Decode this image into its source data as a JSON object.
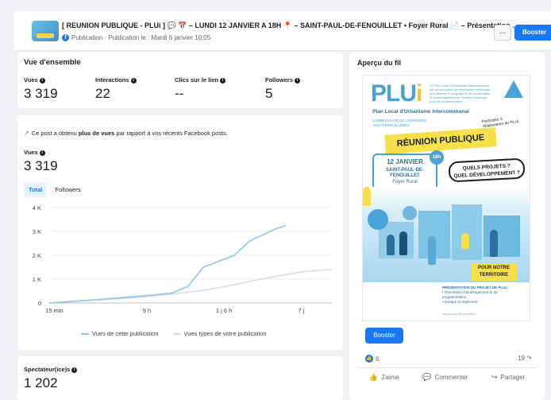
{
  "header": {
    "title": "[ REUNION PUBLIQUE - PLUi ] 💬 📅 – LUNDI 12 JANVIER A 18H 📍 – SAINT-PAUL-DE-FENOUILLET • Foyer Rural 📄 – Présentation ...",
    "subtitle": "Publication · Publication le : Mardi 6 janvier 10:05",
    "more_label": "...",
    "boost_label": "Booster"
  },
  "overview": {
    "title": "Vue d'ensemble",
    "metrics": [
      {
        "label": "Vues",
        "value": "3 319"
      },
      {
        "label": "Interactions",
        "value": "22"
      },
      {
        "label": "Clics sur le lien",
        "value": "--"
      },
      {
        "label": "Followers",
        "value": "5"
      }
    ]
  },
  "views_panel": {
    "insight_prefix": "Ce post a obtenu ",
    "insight_bold": "plus de vues",
    "insight_suffix": " par rapport à vos récents Facebook posts.",
    "label": "Vues",
    "value": "3 319",
    "tabs": [
      "Total",
      "Followers"
    ],
    "legend_this": "Vues de cette publication",
    "legend_typical": "Vues types de votre publication"
  },
  "spectators": {
    "label": "Spectateur(ice)s",
    "value": "1 202"
  },
  "preview": {
    "title": "Aperçu du fil",
    "boost_label": "Booster",
    "reactions": "6",
    "shares": "19",
    "like_label": "J'aime",
    "comment_label": "Commenter",
    "share_label": "Partager",
    "poster": {
      "logo_a": "PLU",
      "logo_b": "i",
      "small_text": "Le Plan Local d'Urbanisme Intercommunal est un document de planification territoriale qui présente le programme de construction et d'aménagement de l'entière commune pour les années à venir.",
      "subtitle": "Plan Local d'Urbanisme Intercommunal",
      "community": "COMMUNAUTÉ DE COMMUNES AGLY FENOUILLÈDES",
      "script": "Participez à l'élaboration du PLUi",
      "banner": "RÉUNION PUBLIQUE",
      "date": "12 JANVIER",
      "place": "SAINT-PAUL-DE-FENOUILLET",
      "venue": "Foyer Rural",
      "time": "18h",
      "q1": "QUELS PROJETS ?",
      "q2": "QUEL DÉVELOPPEMENT ?",
      "terr1": "POUR NOTRE",
      "terr2": "TERRITOIRE",
      "foot_bold": "PRÉSENTATION DU PROJET DE PLUi :",
      "foot1": "• Orientation d'aménagement et de programmation",
      "foot2": "• Zonage et règlement",
      "foot3": "www.cc-agly-fenouilledes.fr"
    }
  },
  "colors": {
    "accent": "#1877f2",
    "series_this": "#8cc8ef",
    "series_typical": "#d9dde2"
  },
  "chart_data": {
    "type": "line",
    "x_ticks": [
      "15 min",
      "9 h",
      "1 j 6 h",
      "7 j"
    ],
    "y_ticks": [
      "0",
      "1 K",
      "2 K",
      "3 K",
      "4 K"
    ],
    "ylim": [
      0,
      4000
    ],
    "series": [
      {
        "name": "Vues de cette publication",
        "points": [
          [
            0,
            0
          ],
          [
            0.08,
            60
          ],
          [
            0.2,
            150
          ],
          [
            0.3,
            240
          ],
          [
            0.4,
            330
          ],
          [
            0.48,
            420
          ],
          [
            0.54,
            700
          ],
          [
            0.6,
            1500
          ],
          [
            0.66,
            1750
          ],
          [
            0.72,
            2000
          ],
          [
            0.78,
            2600
          ],
          [
            0.84,
            2900
          ],
          [
            0.88,
            3100
          ],
          [
            0.92,
            3250
          ]
        ]
      },
      {
        "name": "Vues types de votre publication",
        "points": [
          [
            0,
            0
          ],
          [
            0.1,
            70
          ],
          [
            0.2,
            130
          ],
          [
            0.3,
            200
          ],
          [
            0.4,
            280
          ],
          [
            0.5,
            400
          ],
          [
            0.6,
            530
          ],
          [
            0.7,
            720
          ],
          [
            0.8,
            950
          ],
          [
            0.9,
            1150
          ],
          [
            1.0,
            1330
          ],
          [
            1.1,
            1400
          ]
        ]
      }
    ]
  }
}
